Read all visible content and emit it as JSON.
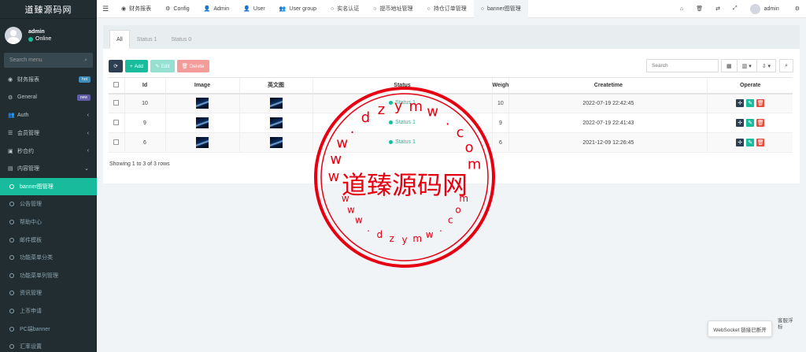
{
  "sidebar": {
    "brand": "道臻源码网",
    "user": {
      "name": "admin",
      "status": "Online"
    },
    "search_placeholder": "Search menu",
    "items": [
      {
        "label": "财务报表",
        "icon": "dashboard-icon",
        "glyph": "◉",
        "badge": "hot"
      },
      {
        "label": "General",
        "icon": "cogs-icon",
        "glyph": "⚙",
        "badge": "new"
      },
      {
        "label": "Auth",
        "icon": "group-icon",
        "glyph": "👥",
        "chevron": "‹"
      },
      {
        "label": "会员管理",
        "icon": "list-icon",
        "glyph": "☰",
        "chevron": "‹"
      },
      {
        "label": "秒合约",
        "icon": "calendar-icon",
        "glyph": "▣",
        "chevron": "‹"
      },
      {
        "label": "内容管理",
        "icon": "folder-icon",
        "glyph": "▤",
        "chevron": "⌄"
      }
    ],
    "subitems": [
      "banner图管理",
      "公告管理",
      "帮助中心",
      "邮件模板",
      "功能菜单分类",
      "功能菜单列管理",
      "资讯管理",
      "上币申请",
      "PC端banner",
      "汇率设置"
    ]
  },
  "topbar": {
    "tabs": [
      {
        "label": "财务报表",
        "glyph": "◉"
      },
      {
        "label": "Config",
        "glyph": "⚙"
      },
      {
        "label": "Admin",
        "glyph": "👤"
      },
      {
        "label": "User",
        "glyph": "👤"
      },
      {
        "label": "User group",
        "glyph": "👥"
      },
      {
        "label": "实名认证",
        "glyph": "○"
      },
      {
        "label": "提币地址管理",
        "glyph": "○"
      },
      {
        "label": "持仓订单管理",
        "glyph": "○"
      },
      {
        "label": "banner图管理",
        "glyph": "○"
      }
    ],
    "user_name": "admin"
  },
  "panel": {
    "tabs": [
      "All",
      "Status 1",
      "Status 0"
    ],
    "toolbar": {
      "add": "Add",
      "edit": "Edit",
      "delete": "Delete"
    },
    "search_placeholder": "Search",
    "columns": [
      "Id",
      "Image",
      "英文图",
      "Status",
      "Weigh",
      "Createtime",
      "Operate"
    ],
    "rows": [
      {
        "id": "10",
        "status": "Status 1",
        "weigh": "10",
        "createtime": "2022-07-19 22:42:45"
      },
      {
        "id": "9",
        "status": "Status 1",
        "weigh": "9",
        "createtime": "2022-07-19 22:41:43"
      },
      {
        "id": "6",
        "status": "Status 1",
        "weigh": "6",
        "createtime": "2021-12-09 12:26:45"
      }
    ],
    "pagination": "Showing 1 to 3 of 3 rows"
  },
  "watermark": {
    "main": "道臻源码网",
    "url": "www.dzymw.com"
  },
  "toast": "WebSocket 链接已断开",
  "float_label": "客服浮标",
  "colors": {
    "accent": "#18bc9c",
    "sidebar": "#222d32",
    "stamp": "#e60012"
  }
}
